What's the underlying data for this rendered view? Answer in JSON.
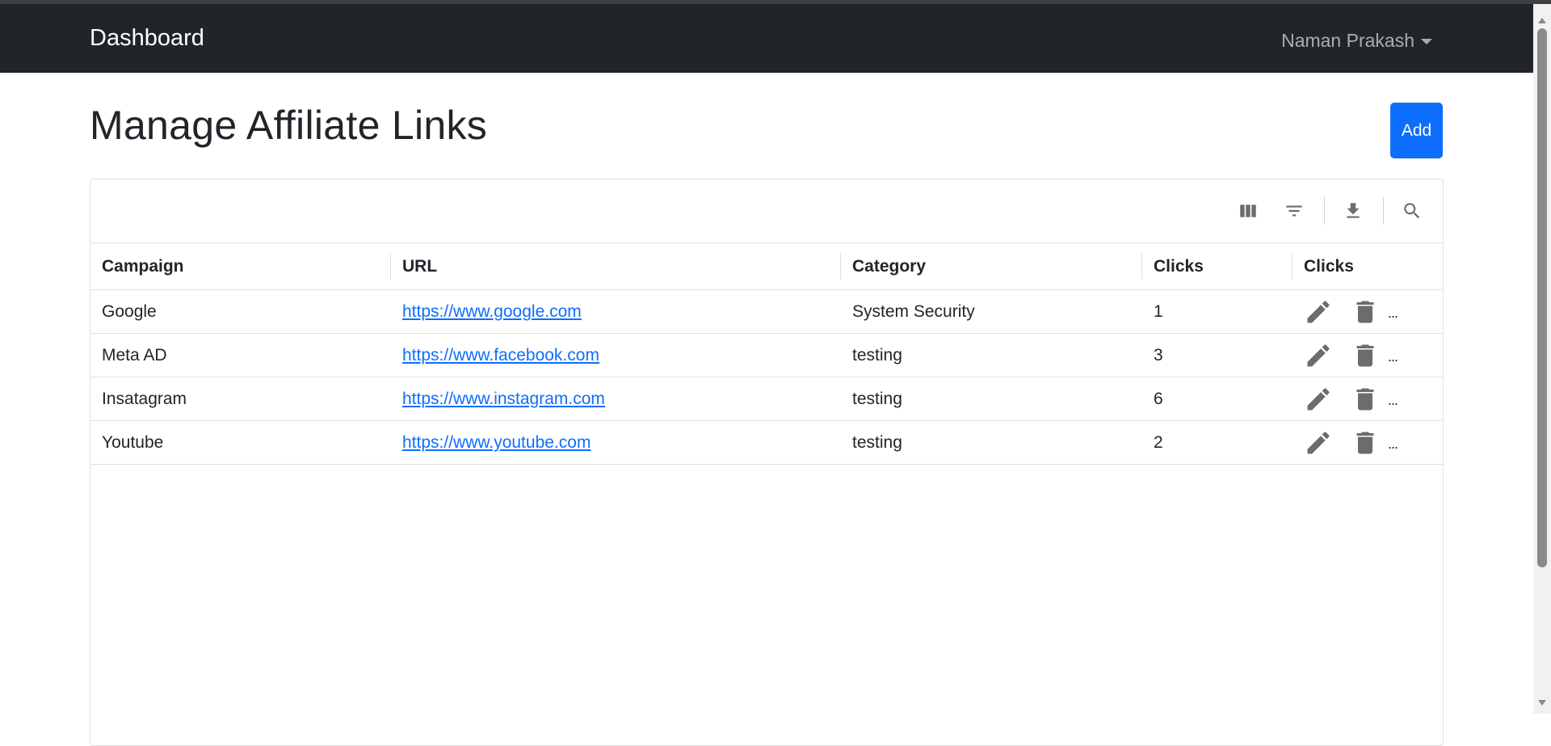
{
  "navbar": {
    "brand": "Dashboard",
    "user_name": "Naman Prakash"
  },
  "page": {
    "title": "Manage Affiliate Links",
    "add_label": "Add"
  },
  "toolbar": {
    "icons": [
      "columns-icon",
      "filter-icon",
      "download-icon",
      "search-icon"
    ]
  },
  "table": {
    "columns": [
      "Campaign",
      "URL",
      "Category",
      "Clicks",
      "Clicks"
    ],
    "rows": [
      {
        "campaign": "Google",
        "url": "https://www.google.com",
        "category": "System Security",
        "clicks": "1"
      },
      {
        "campaign": "Meta AD",
        "url": "https://www.facebook.com",
        "category": "testing",
        "clicks": "3"
      },
      {
        "campaign": "Insatagram",
        "url": "https://www.instagram.com",
        "category": "testing",
        "clicks": "6"
      },
      {
        "campaign": "Youtube",
        "url": "https://www.youtube.com",
        "category": "testing",
        "clicks": "2"
      }
    ],
    "more_label": "..."
  },
  "colors": {
    "navbar_bg": "#212529",
    "primary": "#0d6efd",
    "icon_gray": "#6c6c6c"
  }
}
